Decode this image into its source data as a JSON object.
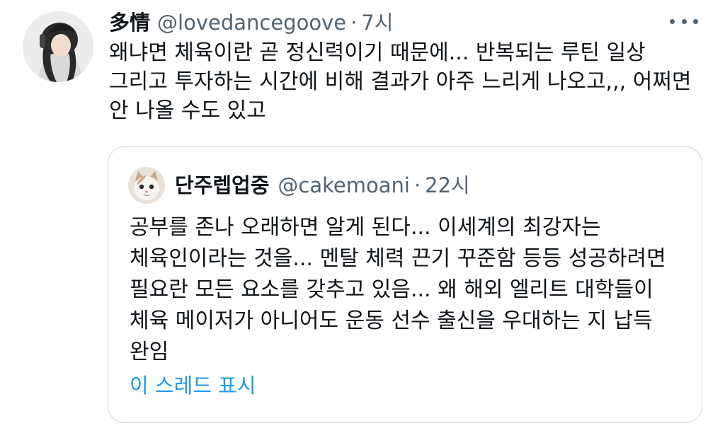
{
  "tweet": {
    "display_name": "多情",
    "handle": "@lovedancegoove",
    "separator": "·",
    "time": "7시",
    "text": "왜냐면 체육이란 곧 정신력이기 때문에... 반복되는 루틴 일상 그리고 투자하는 시간에 비해 결과가 아주 느리게 나오고,,, 어쩌면 안 나올 수도 있고",
    "avatar_icon": "profile-photo",
    "more_icon": "more-options-icon"
  },
  "quote": {
    "display_name": "단주렙업중",
    "handle": "@cakemoani",
    "separator": "·",
    "time": "22시",
    "text": "공부를 존나 오래하면 알게 된다... 이세계의 최강자는 체육인이라는 것을... 멘탈 체력 끈기 꾸준함 등등 성공하려면 필요란 모든 요소를 갖추고 있음... 왜 해외 엘리트 대학들이 체육 메이저가 아니어도 운동 선수 출신을 우대하는 지 납득 완임",
    "show_thread": "이 스레드 표시",
    "avatar_icon": "cat-avatar"
  },
  "colors": {
    "text_primary": "#0f1419",
    "text_secondary": "#536471",
    "link": "#1d9bf0",
    "border": "#cfd9de"
  }
}
